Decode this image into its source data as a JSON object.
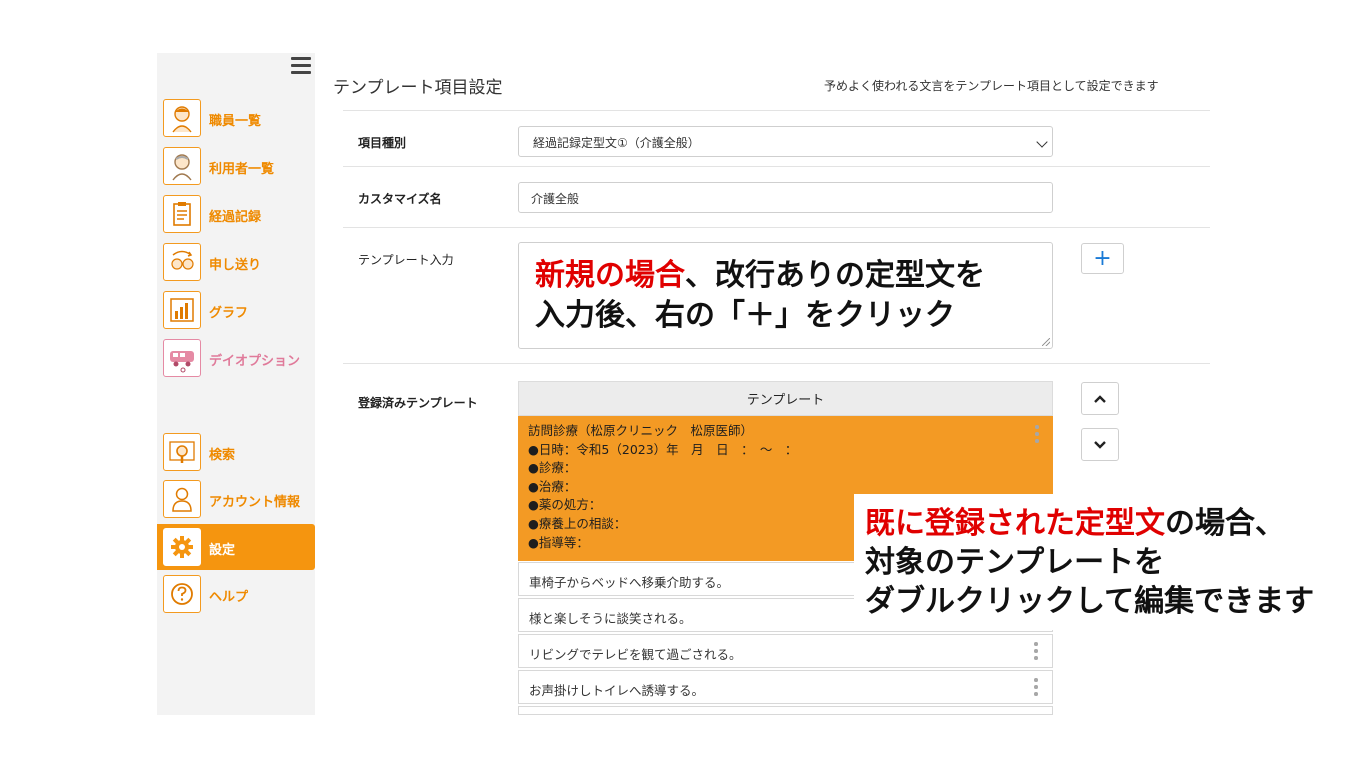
{
  "sidebar": {
    "items": [
      {
        "label": "職員一覧",
        "icon": "staff-icon"
      },
      {
        "label": "利用者一覧",
        "icon": "user-icon"
      },
      {
        "label": "経過記録",
        "icon": "clipboard-icon"
      },
      {
        "label": "申し送り",
        "icon": "handover-icon"
      },
      {
        "label": "グラフ",
        "icon": "chart-icon"
      },
      {
        "label": "デイオプション",
        "icon": "van-icon"
      },
      {
        "label": "検索",
        "icon": "search-icon"
      },
      {
        "label": "アカウント情報",
        "icon": "account-icon"
      },
      {
        "label": "設定",
        "icon": "gear-icon"
      },
      {
        "label": "ヘルプ",
        "icon": "help-icon"
      }
    ],
    "active": "設定"
  },
  "page": {
    "title": "テンプレート項目設定",
    "description": "予めよく使われる文言をテンプレート項目として設定できます"
  },
  "form": {
    "type_label": "項目種別",
    "type_value": "経過記録定型文①（介護全般）",
    "custom_name_label": "カスタマイズ名",
    "custom_name_value": "介護全般",
    "template_input_label": "テンプレート入力",
    "add_button": "+",
    "registered_label": "登録済みテンプレート"
  },
  "templates": {
    "header": "テンプレート",
    "selected_lines": [
      "訪問診療（松原クリニック　松原医師）",
      "●日時：令和5（2023）年　月　日　：　～　：",
      "●診療：",
      "●治療：",
      "●薬の処方：",
      "●療養上の相談：",
      "●指導等："
    ],
    "rows": [
      "車椅子からベッドへ移乗介助する。",
      "様と楽しそうに談笑される。",
      "リビングでテレビを観て過ごされる。",
      "お声掛けしトイレへ誘導する。"
    ]
  },
  "annotations": {
    "new_red": "新規の場合",
    "new_rest1": "、改行ありの定型文を",
    "new_line2": "入力後、右の「＋」をクリック",
    "existing_red": "既に登録された定型文",
    "existing_rest1": "の場合、",
    "existing_line2": "対象のテンプレートを",
    "existing_line3": "ダブルクリックして編集できます"
  },
  "colors": {
    "accent": "#f5950f",
    "selected_row": "#f39a24",
    "annotation_red": "#e00000"
  }
}
